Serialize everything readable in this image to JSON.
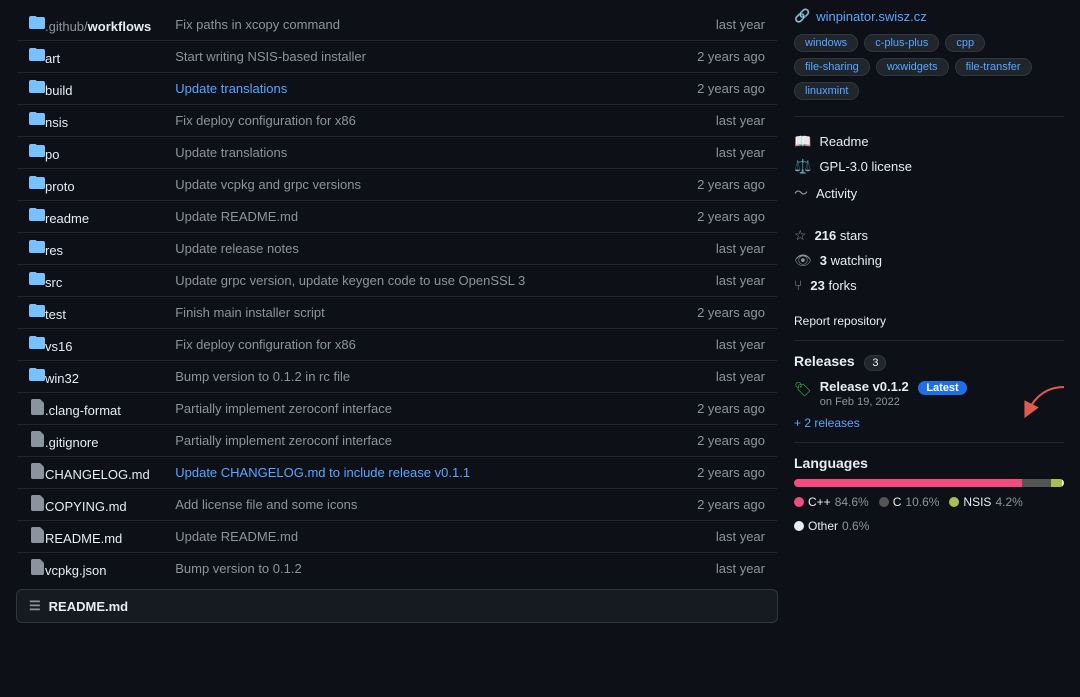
{
  "files": [
    {
      "type": "folder",
      "name": ".github/workflows",
      "name_prefix": ".github/",
      "name_bold": "workflows",
      "commit": "Fix paths in xcopy command",
      "time": "last year"
    },
    {
      "type": "folder",
      "name": "art",
      "commit": "Start writing NSIS-based installer",
      "time": "2 years ago"
    },
    {
      "type": "folder",
      "name": "build",
      "commit": "Update translations",
      "commit_is_link": true,
      "time": "2 years ago"
    },
    {
      "type": "folder",
      "name": "nsis",
      "commit": "Fix deploy configuration for x86",
      "time": "last year"
    },
    {
      "type": "folder",
      "name": "po",
      "commit": "Update translations",
      "time": "last year"
    },
    {
      "type": "folder",
      "name": "proto",
      "commit": "Update vcpkg and grpc versions",
      "time": "2 years ago"
    },
    {
      "type": "folder",
      "name": "readme",
      "commit": "Update README.md",
      "time": "2 years ago"
    },
    {
      "type": "folder",
      "name": "res",
      "commit": "Update release notes",
      "time": "last year"
    },
    {
      "type": "folder",
      "name": "src",
      "commit": "Update grpc version, update keygen code to use OpenSSL 3",
      "time": "last year"
    },
    {
      "type": "folder",
      "name": "test",
      "commit": "Finish main installer script",
      "time": "2 years ago"
    },
    {
      "type": "folder",
      "name": "vs16",
      "commit": "Fix deploy configuration for x86",
      "time": "last year"
    },
    {
      "type": "folder",
      "name": "win32",
      "commit": "Bump version to 0.1.2 in rc file",
      "time": "last year"
    },
    {
      "type": "file",
      "name": ".clang-format",
      "commit": "Partially implement zeroconf interface",
      "time": "2 years ago"
    },
    {
      "type": "file",
      "name": ".gitignore",
      "commit": "Partially implement zeroconf interface",
      "time": "2 years ago"
    },
    {
      "type": "file",
      "name": "CHANGELOG.md",
      "commit": "Update CHANGELOG.md to include release v0.1.1",
      "commit_is_link": true,
      "time": "2 years ago"
    },
    {
      "type": "file",
      "name": "COPYING.md",
      "commit": "Add license file and some icons",
      "time": "2 years ago"
    },
    {
      "type": "file",
      "name": "README.md",
      "commit": "Update README.md",
      "time": "last year"
    },
    {
      "type": "file",
      "name": "vcpkg.json",
      "commit": "Bump version to 0.1.2",
      "time": "last year"
    }
  ],
  "readme_bar": {
    "icon": "☰",
    "label": "README.md"
  },
  "sidebar": {
    "website": {
      "label": "winpinator.swisz.cz",
      "url": "#"
    },
    "tags": [
      "windows",
      "c-plus-plus",
      "cpp",
      "file-sharing",
      "wxwidgets",
      "file-transfer",
      "linuxmint"
    ],
    "links": [
      {
        "icon": "📖",
        "label": "Readme",
        "icon_name": "readme-icon"
      },
      {
        "icon": "⚖️",
        "label": "GPL-3.0 license",
        "icon_name": "license-icon"
      },
      {
        "icon": "〜",
        "label": "Activity",
        "icon_name": "activity-icon"
      }
    ],
    "stats": [
      {
        "icon": "☆",
        "count": "216",
        "label": "stars",
        "icon_name": "star-icon"
      },
      {
        "icon": "👁",
        "count": "3",
        "label": "watching",
        "icon_name": "watch-icon"
      },
      {
        "icon": "⑂",
        "count": "23",
        "label": "forks",
        "icon_name": "fork-icon"
      }
    ],
    "report": "Report repository"
  },
  "releases": {
    "title": "Releases",
    "count": "3",
    "latest": {
      "name": "Release v0.1.2",
      "badge": "Latest",
      "date": "on Feb 19, 2022"
    },
    "more_link": "+ 2 releases"
  },
  "languages": {
    "title": "Languages",
    "items": [
      {
        "name": "C++",
        "percent": "84.6",
        "color": "#f34b7d",
        "bar_flex": 84.6
      },
      {
        "name": "C",
        "percent": "10.6",
        "color": "#555555",
        "bar_flex": 10.6
      },
      {
        "name": "NSIS",
        "percent": "4.2",
        "color": "#a9c04e",
        "bar_flex": 4.2
      },
      {
        "name": "Other",
        "percent": "0.6",
        "color": "#e6edf3",
        "bar_flex": 0.6
      }
    ]
  }
}
